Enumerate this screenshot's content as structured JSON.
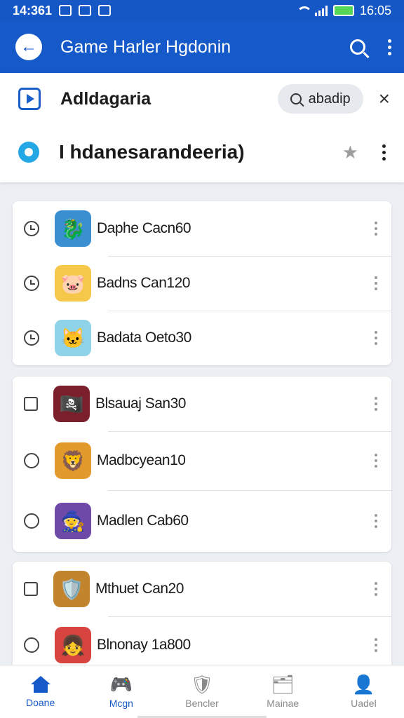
{
  "status_bar": {
    "time": "14:361",
    "battery_text": "16:05"
  },
  "app_bar": {
    "title": "Game Harler Hgdonin"
  },
  "subheader": {
    "title": "Adldagaria",
    "search_chip": "abadip",
    "close_symbol": "×",
    "heading": "I hdanesarandeeria)",
    "star_symbol": "★"
  },
  "lists": [
    {
      "items": [
        {
          "name": "Daphe Cacn60",
          "control": "clock",
          "icon": "dragon-warrior-icon",
          "icon_glyph": "🐉",
          "icon_bg": "#3a8fd0"
        },
        {
          "name": "Badns Can120",
          "control": "clock",
          "icon": "pink-creature-icon",
          "icon_glyph": "🐷",
          "icon_bg": "#f6c84a"
        },
        {
          "name": "Badata Oeto30",
          "control": "clock",
          "icon": "cat-hero-icon",
          "icon_glyph": "🐱",
          "icon_bg": "#8fd3e8"
        }
      ]
    },
    {
      "items": [
        {
          "name": "Blsauaj San30",
          "control": "box",
          "icon": "pirate-girl-icon",
          "icon_glyph": "🏴‍☠️",
          "icon_bg": "#7a1f2b"
        },
        {
          "name": "Madbcyean10",
          "control": "radio",
          "icon": "brawler-icon",
          "icon_glyph": "🦁",
          "icon_bg": "#e39a2d"
        },
        {
          "name": "Madlen Cab60",
          "control": "radio",
          "icon": "hooded-hero-icon",
          "icon_glyph": "🧙",
          "icon_bg": "#6d4aa8"
        }
      ]
    },
    {
      "items": [
        {
          "name": "Mthuet Can20",
          "control": "box",
          "icon": "knight-icon",
          "icon_glyph": "🛡️",
          "icon_bg": "#c2852e"
        },
        {
          "name": "Blnonay 1a800",
          "control": "radio",
          "icon": "red-hood-icon",
          "icon_glyph": "👧",
          "icon_bg": "#d7433f"
        }
      ]
    }
  ],
  "bottom_nav": [
    {
      "label": "Doane",
      "icon": "home-icon",
      "glyph": "",
      "active": true
    },
    {
      "label": "Mcgn",
      "icon": "gamepad-icon",
      "glyph": "🎮",
      "active": false
    },
    {
      "label": "Bencler",
      "icon": "shield-icon",
      "glyph": "🛡",
      "active": false
    },
    {
      "label": "Mainae",
      "icon": "folder-icon",
      "glyph": "🗂",
      "active": false
    },
    {
      "label": "Uadel",
      "icon": "profile-icon",
      "glyph": "👤",
      "active": false
    }
  ],
  "colors": {
    "primary": "#1659c8",
    "status_bar": "#1557c4",
    "background": "#eceff3"
  }
}
